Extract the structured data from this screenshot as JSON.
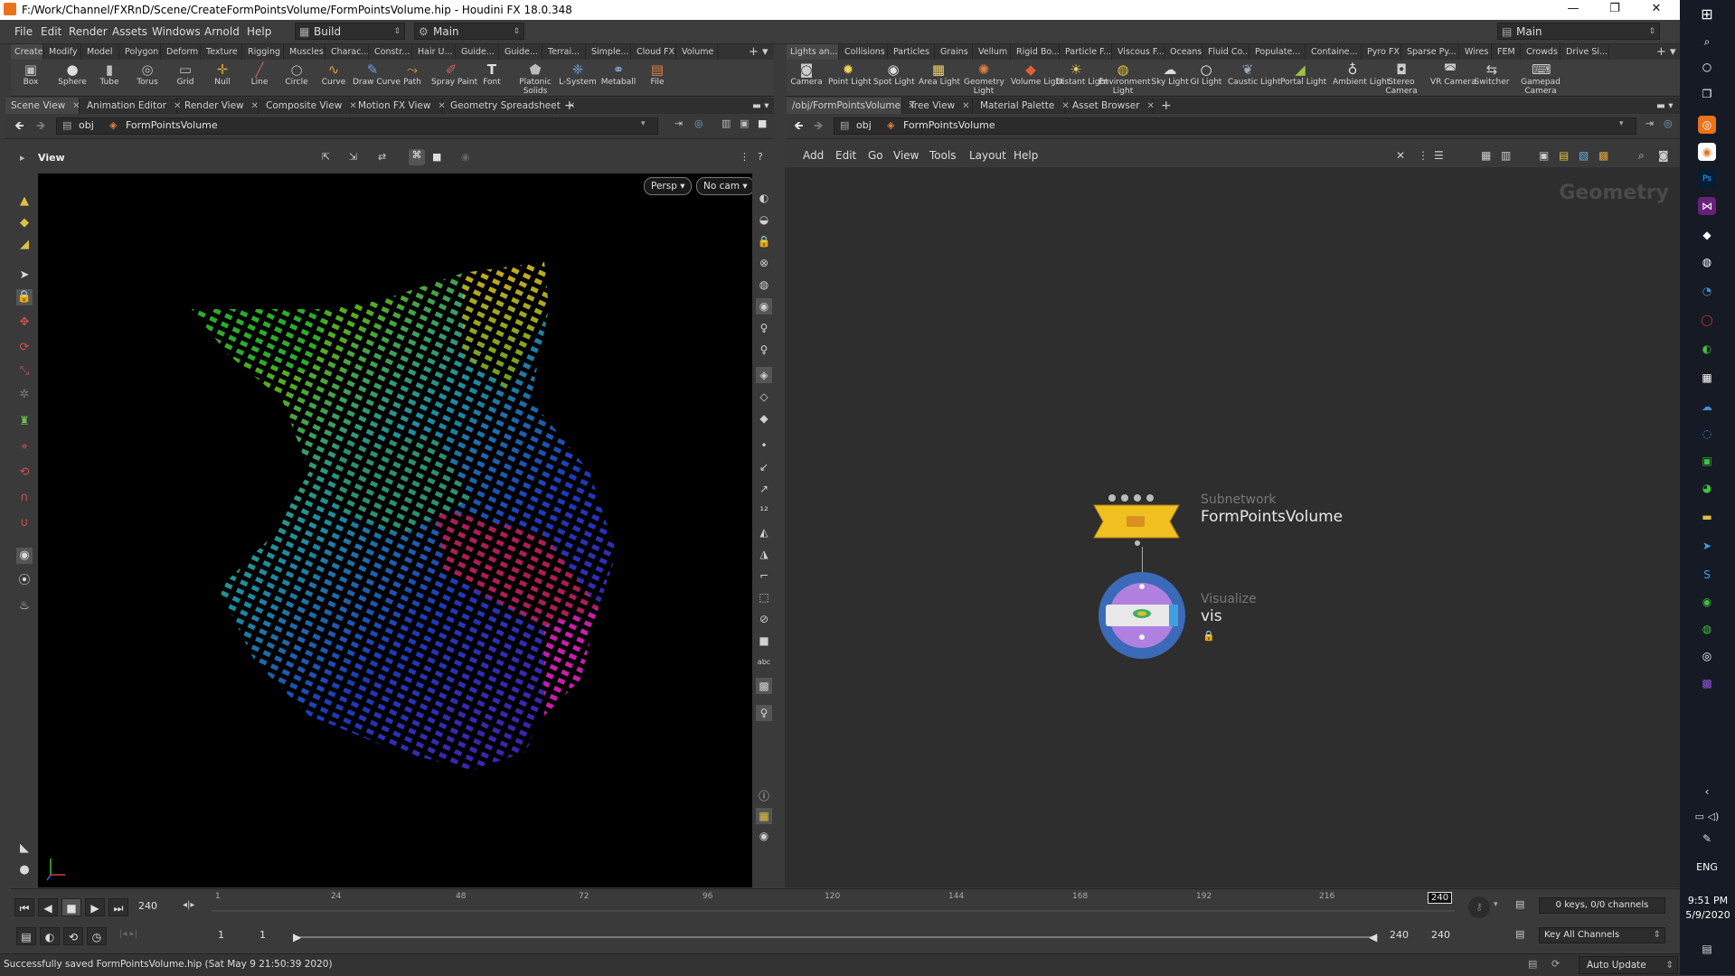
{
  "titlebar": {
    "title": "F:/Work/Channel/FXRnD/Scene/CreateFormPointsVolume/FormPointsVolume.hip - Houdini FX 18.0.348",
    "minimize": "—",
    "maximize": "❐",
    "close": "✕"
  },
  "menubar": {
    "items": [
      "File",
      "Edit",
      "Render",
      "Assets",
      "Windows",
      "Arnold",
      "Help"
    ],
    "desktop_combo": "Build",
    "layout_combo": "Main",
    "right_combo": "Main"
  },
  "shelf_left": {
    "tabs": [
      "Create",
      "Modify",
      "Model",
      "Polygon",
      "Deform",
      "Texture",
      "Rigging",
      "Muscles",
      "Charac...",
      "Constr...",
      "Hair U...",
      "Guide...",
      "Guide...",
      "Terrai...",
      "Simple...",
      "Cloud FX",
      "Volume"
    ],
    "tools": [
      {
        "label": "Box",
        "icon": "▣"
      },
      {
        "label": "Sphere",
        "icon": "●"
      },
      {
        "label": "Tube",
        "icon": "▮"
      },
      {
        "label": "Torus",
        "icon": "◎"
      },
      {
        "label": "Grid",
        "icon": "▭"
      },
      {
        "label": "Null",
        "icon": "✛"
      },
      {
        "label": "Line",
        "icon": "╱"
      },
      {
        "label": "Circle",
        "icon": "○"
      },
      {
        "label": "Curve",
        "icon": "∿"
      },
      {
        "label": "Draw Curve",
        "icon": "✎"
      },
      {
        "label": "Path",
        "icon": "⤳"
      },
      {
        "label": "Spray Paint",
        "icon": "✐"
      },
      {
        "label": "Font",
        "icon": "T"
      },
      {
        "label": "Platonic Solids",
        "icon": "⬟"
      },
      {
        "label": "L-System",
        "icon": "❈"
      },
      {
        "label": "Metaball",
        "icon": "⚭"
      },
      {
        "label": "File",
        "icon": "▤"
      }
    ]
  },
  "shelf_right": {
    "tabs": [
      "Lights an...",
      "Collisions",
      "Particles",
      "Grains",
      "Vellum",
      "Rigid Bo...",
      "Particle F...",
      "Viscous F...",
      "Oceans",
      "Fluid Co...",
      "Populate...",
      "Containe...",
      "Pyro FX",
      "Sparse Py...",
      "Wires",
      "FEM",
      "Crowds",
      "Drive Si..."
    ],
    "tools": [
      {
        "label": "Camera",
        "icon": "◙"
      },
      {
        "label": "Point Light",
        "icon": "✹"
      },
      {
        "label": "Spot Light",
        "icon": "◉"
      },
      {
        "label": "Area Light",
        "icon": "▦"
      },
      {
        "label": "Geometry Light",
        "icon": "✺"
      },
      {
        "label": "Volume Light",
        "icon": "◆"
      },
      {
        "label": "Distant Light",
        "icon": "☀"
      },
      {
        "label": "Environment Light",
        "icon": "◍"
      },
      {
        "label": "Sky Light",
        "icon": "☁"
      },
      {
        "label": "GI Light",
        "icon": "○"
      },
      {
        "label": "Caustic Light",
        "icon": "❦"
      },
      {
        "label": "Portal Light",
        "icon": "◢"
      },
      {
        "label": "Ambient Light",
        "icon": "♁"
      },
      {
        "label": "Stereo Camera",
        "icon": "◘"
      },
      {
        "label": "VR Camera",
        "icon": "◚"
      },
      {
        "label": "Switcher",
        "icon": "⇆"
      },
      {
        "label": "Gamepad Camera",
        "icon": "⌨"
      }
    ]
  },
  "left_pane": {
    "tabs": [
      "Scene View",
      "Animation Editor",
      "Render View",
      "Composite View",
      "Motion FX View",
      "Geometry Spreadsheet"
    ],
    "path_root": "obj",
    "path_node": "FormPointsVolume",
    "view_label": "View",
    "persp": "Persp ▾",
    "camera": "No cam ▾"
  },
  "right_pane": {
    "tabs": [
      "/obj/FormPointsVolume",
      "Tree View",
      "Material Palette",
      "Asset Browser"
    ],
    "path_root": "obj",
    "path_node": "FormPointsVolume",
    "menu": [
      "Add",
      "Edit",
      "Go",
      "View",
      "Tools",
      "Layout",
      "Help"
    ],
    "context_label": "Geometry",
    "nodes": [
      {
        "type": "Subnetwork",
        "name": "FormPointsVolume"
      },
      {
        "type": "Visualize",
        "name": "vis"
      }
    ]
  },
  "timeline": {
    "current_frame": "240",
    "ticks": [
      "1",
      "24",
      "48",
      "72",
      "96",
      "120",
      "144",
      "168",
      "192",
      "216"
    ],
    "end_marker": "240",
    "range_start": "1",
    "range_start2": "1",
    "range_end": "240",
    "range_end2": "240",
    "keys_info": "0 keys, 0/0 channels",
    "key_all": "Key All Channels",
    "auto_update": "Auto Update"
  },
  "status": {
    "message": "Successfully saved FormPointsVolume.hip (Sat May  9 21:50:39 2020)"
  },
  "taskbar": {
    "lang": "ENG",
    "time": "9:51 PM",
    "date": "5/9/2020"
  }
}
